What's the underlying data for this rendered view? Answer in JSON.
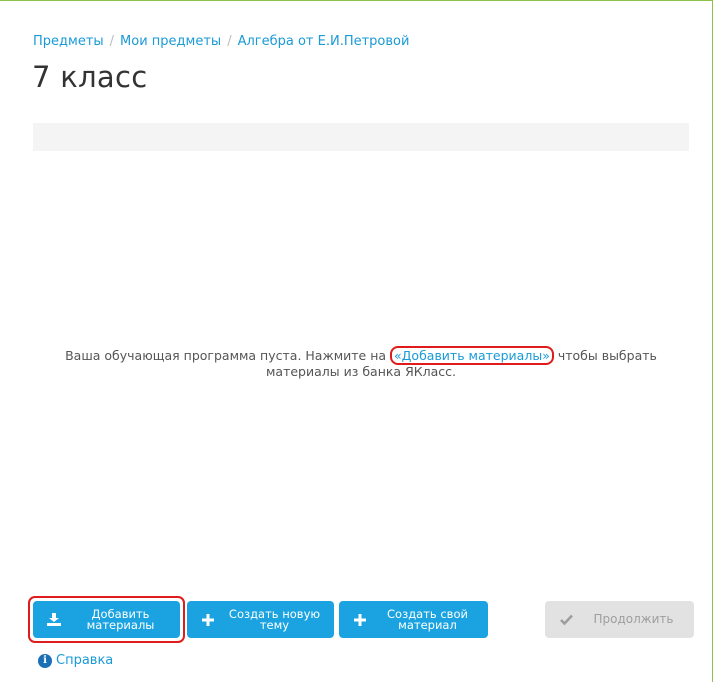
{
  "breadcrumb": {
    "items": [
      "Предметы",
      "Мои предметы",
      "Алгебра от Е.И.Петровой"
    ],
    "separator": "/"
  },
  "page": {
    "title": "7 класс"
  },
  "empty_state": {
    "text_before": "Ваша обучающая программа пуста. Нажмите на ",
    "link": "«Добавить материалы»",
    "text_after": " чтобы выбрать материалы из банка ЯКласс."
  },
  "actions": {
    "add_materials": {
      "label": "Добавить\nматериалы",
      "icon": "download-icon"
    },
    "create_topic": {
      "label": "Создать новую\nтему",
      "icon": "plus-icon"
    },
    "create_material": {
      "label": "Создать свой\nматериал",
      "icon": "plus-icon"
    },
    "continue": {
      "label": "Продолжить",
      "icon": "checkmark-icon"
    }
  },
  "help": {
    "label": "Справка",
    "icon": "info-icon"
  },
  "colors": {
    "accent": "#1aa3e0",
    "link": "#1a9ad7",
    "highlight": "#e01b1b",
    "disabled": "#e2e2e2"
  }
}
